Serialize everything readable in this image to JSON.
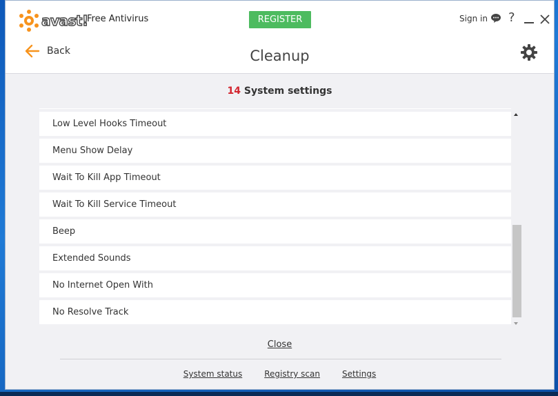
{
  "app": {
    "brand": "avast!",
    "product": "Free Antivirus",
    "register_label": "REGISTER",
    "signin_label": "Sign in",
    "help_label": "?",
    "brand_color": "#f7931d",
    "register_color": "#4dbb5f"
  },
  "nav": {
    "back_label": "Back",
    "title": "Cleanup"
  },
  "summary": {
    "count": "14",
    "label": "System settings"
  },
  "settings_items": [
    "",
    "Low Level Hooks Timeout",
    "Menu Show Delay",
    "Wait To Kill App Timeout",
    "Wait To Kill Service Timeout",
    "Beep",
    "Extended Sounds",
    "No Internet Open With",
    "No Resolve Track"
  ],
  "close_label": "Close",
  "footer": {
    "system_status": "System status",
    "registry_scan": "Registry scan",
    "settings": "Settings"
  }
}
